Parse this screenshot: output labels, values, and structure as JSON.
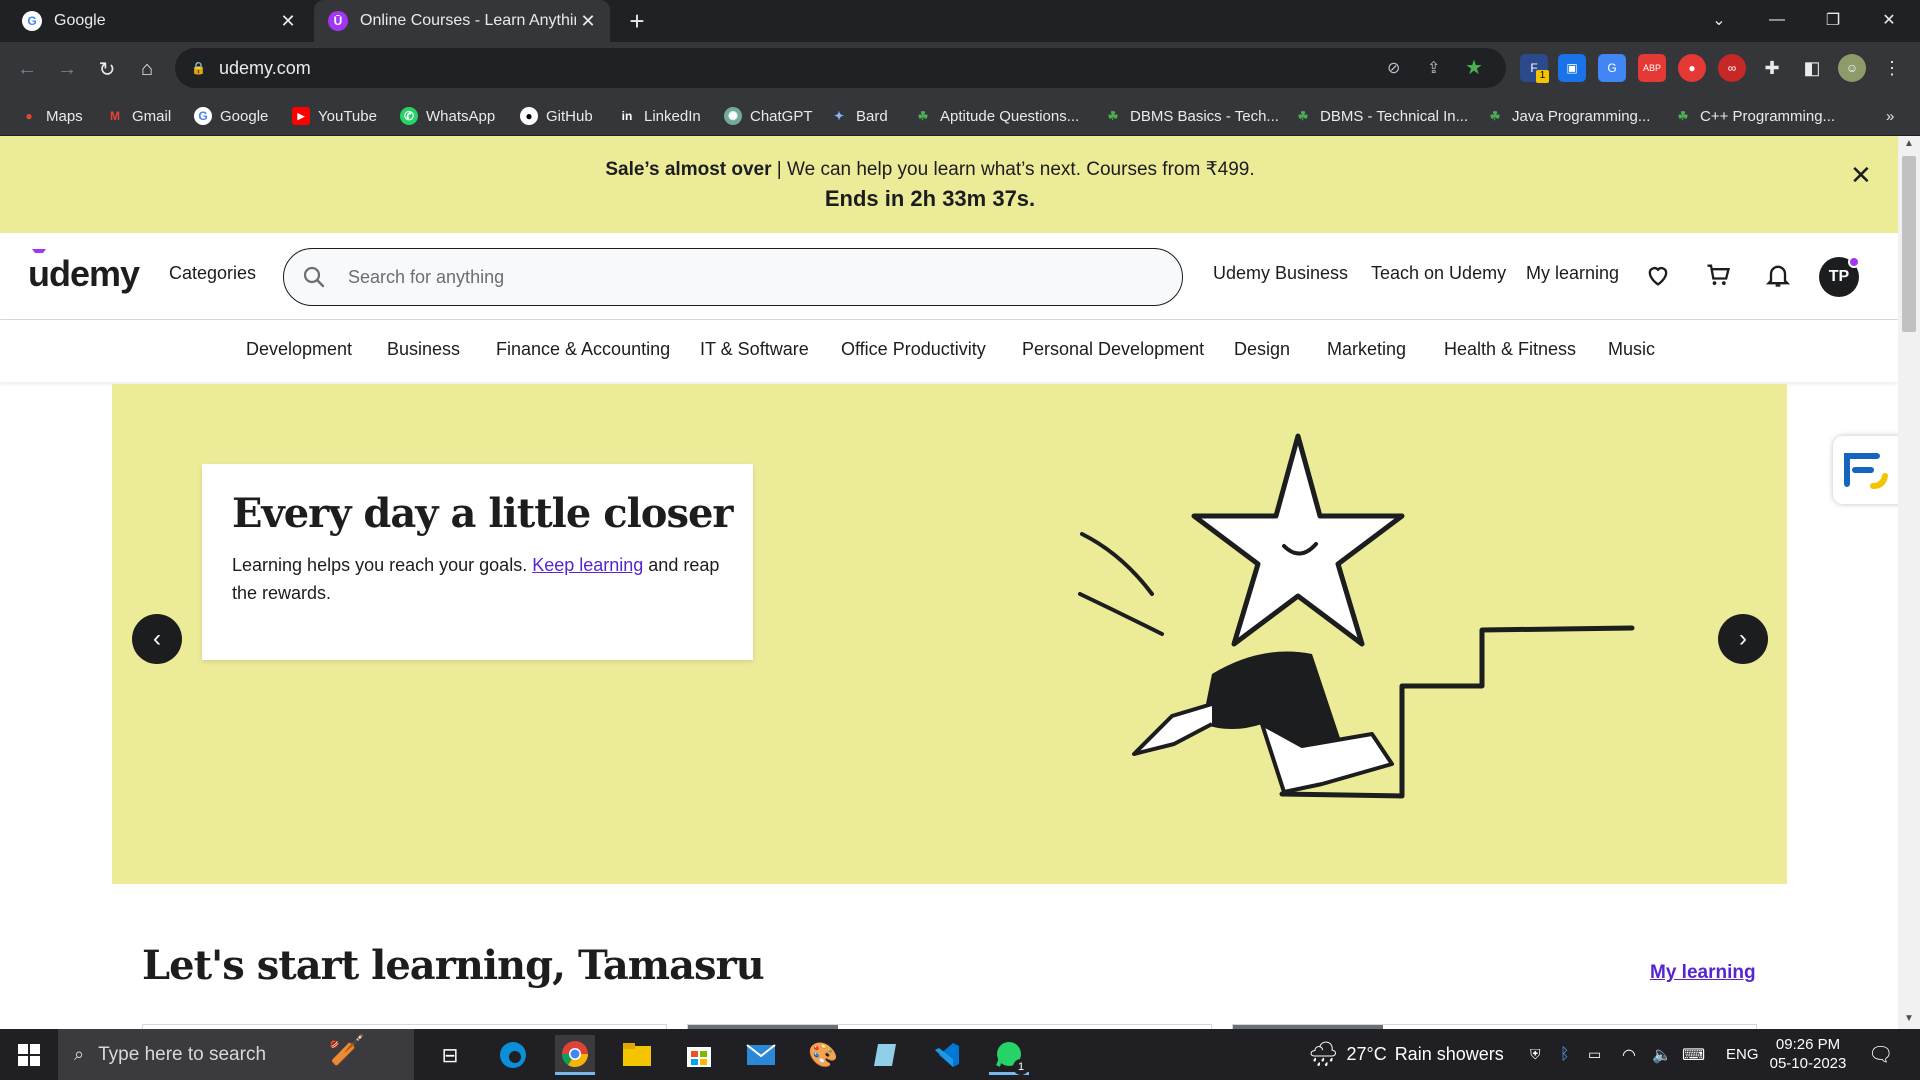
{
  "browser": {
    "tabs": [
      {
        "title": "Google",
        "favicon": "google-icon",
        "active": false
      },
      {
        "title": "Online Courses - Learn Anything",
        "favicon": "udemy-icon",
        "active": true
      }
    ],
    "url": "udemy.com",
    "bookmarks": [
      {
        "label": "Maps",
        "icon": "maps-icon"
      },
      {
        "label": "Gmail",
        "icon": "gmail-icon"
      },
      {
        "label": "Google",
        "icon": "google-icon"
      },
      {
        "label": "YouTube",
        "icon": "youtube-icon"
      },
      {
        "label": "WhatsApp",
        "icon": "whatsapp-icon"
      },
      {
        "label": "GitHub",
        "icon": "github-icon"
      },
      {
        "label": "LinkedIn",
        "icon": "linkedin-icon"
      },
      {
        "label": "ChatGPT",
        "icon": "chatgpt-icon"
      },
      {
        "label": "Bard",
        "icon": "bard-icon"
      },
      {
        "label": "Aptitude Questions...",
        "icon": "leaf-icon"
      },
      {
        "label": "DBMS Basics - Tech...",
        "icon": "leaf-icon"
      },
      {
        "label": "DBMS - Technical In...",
        "icon": "leaf-icon"
      },
      {
        "label": "Java Programming...",
        "icon": "leaf-icon"
      },
      {
        "label": "C++ Programming...",
        "icon": "leaf-icon"
      }
    ],
    "more_bookmarks": "»",
    "extension_badge": "1"
  },
  "sale": {
    "bold": "Sale’s almost over",
    "text": " | We can help you learn what’s next. Courses from ₹499.",
    "countdown": "Ends in 2h 33m 37s."
  },
  "header": {
    "logo": "udemy",
    "categories": "Categories",
    "search_placeholder": "Search for anything",
    "business": "Udemy Business",
    "teach": "Teach on Udemy",
    "my_learning": "My learning",
    "avatar": "TP"
  },
  "category_nav": [
    "Development",
    "Business",
    "Finance & Accounting",
    "IT & Software",
    "Office Productivity",
    "Personal Development",
    "Design",
    "Marketing",
    "Health & Fitness",
    "Music"
  ],
  "hero": {
    "title": "Every day a little closer",
    "text_before": "Learning helps you reach your goals. ",
    "link": "Keep learning",
    "text_after": " and reap the rewards.",
    "bg_color": "#eceb98"
  },
  "greeting": "Let's start learning, Tamasru",
  "my_learning_link": "My learning",
  "taskbar": {
    "search_placeholder": "Type here to search",
    "weather_temp": "27°C",
    "weather_text": "Rain showers",
    "language": "ENG",
    "time": "09:26 PM",
    "date": "05-10-2023",
    "whatsapp_badge": "1"
  },
  "colors": {
    "brand_purple": "#a435f0",
    "link_purple": "#5624d0",
    "sale_yellow": "#eceb98"
  }
}
